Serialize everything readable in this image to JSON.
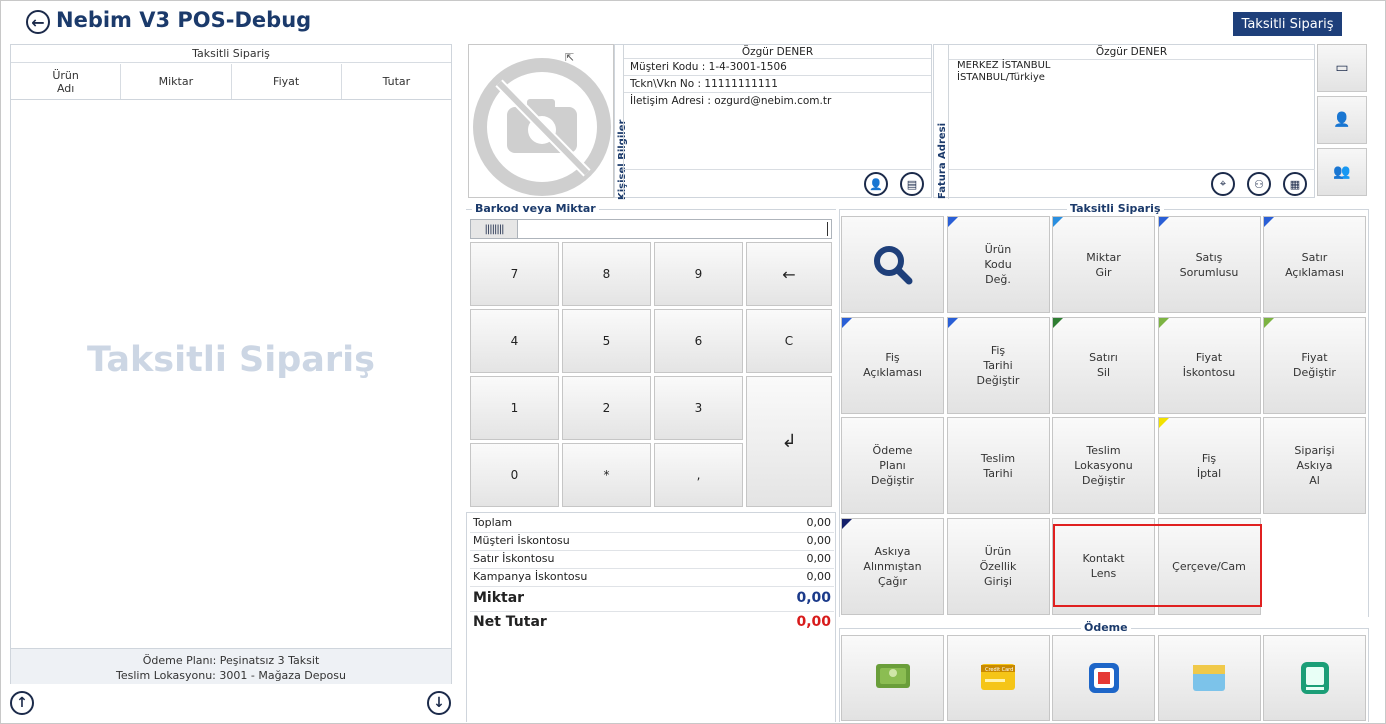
{
  "header": {
    "title": "Nebim V3 POS-Debug",
    "badge": "Taksitli Sipariş"
  },
  "left_panel": {
    "title": "Taksitli Sipariş",
    "columns": [
      "Ürün\nAdı",
      "Miktar",
      "Fiyat",
      "Tutar"
    ],
    "watermark": "Taksitli Sipariş",
    "footer_line1": "Ödeme Planı: Peşinatsız 3 Taksit",
    "footer_line2": "Teslim Lokasyonu: 3001 - Mağaza Deposu"
  },
  "customer": {
    "section_label": "Kişisel Bilgiler",
    "name": "Özgür DENER",
    "code_line": "Müşteri Kodu : 1-4-3001-1506",
    "tckn_line": "Tckn\\Vkn No : 11111111111",
    "contact_line": "İletişim Adresi : ozgurd@nebim.com.tr"
  },
  "invoice": {
    "section_label": "Fatura Adresi",
    "name": "Özgür DENER",
    "line1": "MERKEZ  İSTANBUL",
    "line2": "İSTANBUL/Türkiye"
  },
  "barcode": {
    "label": "Barkod veya Miktar",
    "value": ""
  },
  "keypad": [
    "7",
    "8",
    "9",
    "←",
    "4",
    "5",
    "6",
    "C",
    "1",
    "2",
    "3",
    "↲",
    "0",
    "*",
    ","
  ],
  "totals": {
    "toplam_label": "Toplam",
    "toplam": "0,00",
    "musteri_label": "Müşteri İskontosu",
    "musteri": "0,00",
    "satir_label": "Satır İskontosu",
    "satir": "0,00",
    "kampanya_label": "Kampanya İskontosu",
    "kampanya": "0,00",
    "miktar_label": "Miktar",
    "miktar": "0,00",
    "net_label": "Net Tutar",
    "net": "0,00"
  },
  "actions": {
    "section_label": "Taksitli Sipariş",
    "buttons": [
      {
        "label": "",
        "icon": "search-icon",
        "corner": ""
      },
      {
        "label": "Ürün\nKodu\nDeğ.",
        "corner": "#2a5fd6"
      },
      {
        "label": "Miktar\nGir",
        "corner": "#2a8fe0"
      },
      {
        "label": "Satış\nSorumlusu",
        "corner": "#2a5fd6"
      },
      {
        "label": "Satır\nAçıklaması",
        "corner": "#2a5fd6"
      },
      {
        "label": "Fiş\nAçıklaması",
        "corner": "#2a5fd6"
      },
      {
        "label": "Fiş\nTarihi\nDeğiştir",
        "corner": "#2a5fd6"
      },
      {
        "label": "Satırı\nSil",
        "corner": "#2e7d32"
      },
      {
        "label": "Fiyat\nİskontosu",
        "corner": "#7cb342"
      },
      {
        "label": "Fiyat\nDeğiştir",
        "corner": "#7cb342"
      },
      {
        "label": "Ödeme\nPlanı\nDeğiştir",
        "corner": ""
      },
      {
        "label": "Teslim\nTarihi",
        "corner": ""
      },
      {
        "label": "Teslim\nLokasyonu\nDeğiştir",
        "corner": ""
      },
      {
        "label": "Fiş\nİptal",
        "corner": "#f2e100"
      },
      {
        "label": "Siparişi\nAskıya\nAl",
        "corner": ""
      },
      {
        "label": "Askıya\nAlınmıştan\nÇağır",
        "corner": "#14206b"
      },
      {
        "label": "Ürün\nÖzellik\nGirişi",
        "corner": ""
      },
      {
        "label": "Kontakt\nLens",
        "corner": ""
      },
      {
        "label": "Çerçeve/Cam",
        "corner": ""
      },
      {
        "label": "",
        "corner": "",
        "empty": true
      }
    ]
  },
  "payment": {
    "section_label": "Ödeme",
    "buttons": [
      {
        "icon": "cash-icon"
      },
      {
        "icon": "credit-card-icon",
        "text": "Credit Card"
      },
      {
        "icon": "gift-card-icon"
      },
      {
        "icon": "voucher-icon"
      },
      {
        "icon": "mobile-payment-icon"
      }
    ]
  },
  "colors": {
    "accent": "#1e3f7a",
    "highlight": "#e02020",
    "net_red": "#d81b1b",
    "miktar_blue": "#1b3a8a"
  }
}
